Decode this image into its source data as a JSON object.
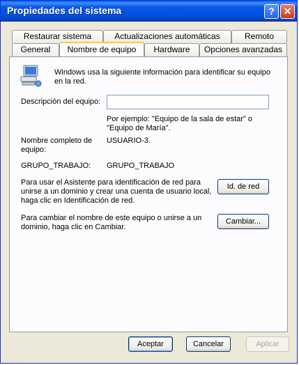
{
  "window": {
    "title": "Propiedades del sistema",
    "help_glyph": "?",
    "close_glyph": "✕"
  },
  "tabs": {
    "row1": [
      "Restaurar sistema",
      "Actualizaciones automáticas",
      "Remoto"
    ],
    "row2": [
      "General",
      "Nombre de equipo",
      "Hardware",
      "Opciones avanzadas"
    ],
    "active": "Nombre de equipo"
  },
  "content": {
    "intro": "Windows usa la siguiente información para identificar su equipo en la red.",
    "description_label": "Descripción del equipo:",
    "description_value": "",
    "example": "Por ejemplo: \"Equipo de la sala de estar\" o \"Equipo de María\".",
    "fullname_label": "Nombre completo de equipo:",
    "fullname_value": "USUARIO-3.",
    "workgroup_label": "GRUPO_TRABAJO:",
    "workgroup_value": "GRUPO_TRABAJO",
    "network_id_text": "Para usar el Asistente para identificación de red para unirse a un dominio y crear una cuenta de usuario local, haga clic en Identificación de red.",
    "network_id_button": "Id. de red",
    "change_text": "Para cambiar el nombre de este equipo o unirse a un dominio, haga clic en Cambiar.",
    "change_button": "Cambiar..."
  },
  "footer": {
    "ok": "Aceptar",
    "cancel": "Cancelar",
    "apply": "Aplicar"
  },
  "icons": {
    "computer": "computer-icon"
  }
}
